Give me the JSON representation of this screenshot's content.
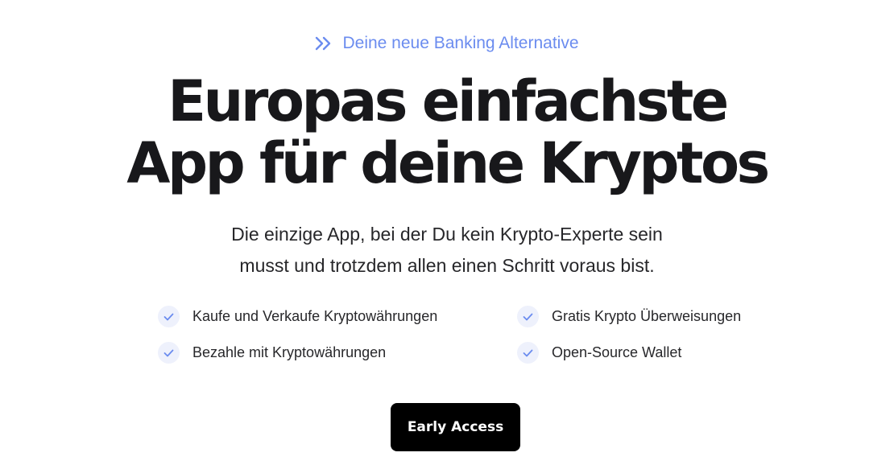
{
  "hero": {
    "eyebrow": "Deine neue Banking Alternative",
    "eyebrow_icon": "double-chevron-right-icon",
    "headline_line1": "Europas einfachste",
    "headline_line2": "App für deine Kryptos",
    "subline_line1": "Die einzige App, bei der Du kein Krypto-Experte sein",
    "subline_line2": "musst und trotzdem allen einen Schritt voraus bist."
  },
  "features": [
    {
      "label": "Kaufe und Verkaufe Kryptowährungen",
      "icon": "check-icon"
    },
    {
      "label": "Gratis Krypto Überweisungen",
      "icon": "check-icon"
    },
    {
      "label": "Bezahle mit Kryptowährungen",
      "icon": "check-icon"
    },
    {
      "label": "Open-Source Wallet",
      "icon": "check-icon"
    }
  ],
  "cta": {
    "label": "Early Access"
  },
  "colors": {
    "accent": "#6b8cef",
    "text": "#18181b",
    "check_bg": "#eef1fc",
    "button_bg": "#000000",
    "button_text": "#ffffff"
  }
}
